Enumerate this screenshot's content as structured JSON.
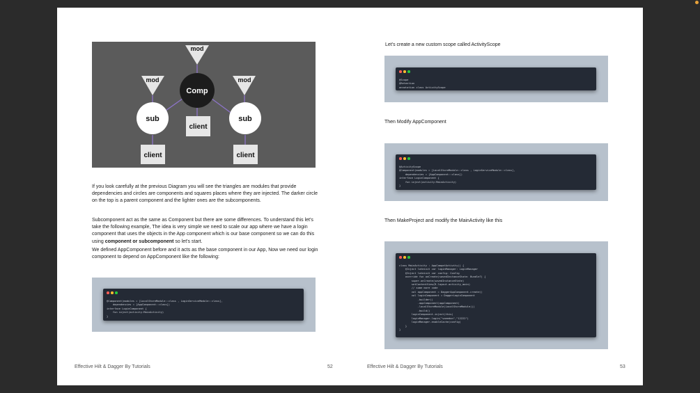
{
  "left_page": {
    "paragraph1": "If you look carefully at the previous Diagram you will see the triangles are modules that provide dependencies and circles are components and squares places where they are injected. The darker circle on the top is a parent component and the lighter ones are the subcomponents.",
    "paragraph2_text": "Subcomponent act as the same as Component but there are some differences. To understand this let's take the following example, The idea is very simple we need to scale our app where we have a login component that uses the objects in the App component which is our base component so we can do this using ",
    "paragraph2_bold": "component or subcomponent",
    "paragraph2_tail": " so let's start.",
    "paragraph3": "We defined AppComponent before and it acts as the base component in our App, Now we need our login component to depend on AppComponent like the following:",
    "footer_title": "Effective Hilt & Dagger By Tutorials",
    "page_number": "52",
    "diagram": {
      "mod_top": "mod",
      "mod_left": "mod",
      "mod_right": "mod",
      "comp": "Comp",
      "sub_left": "sub",
      "sub_right": "sub",
      "client_center": "client",
      "client_left": "client",
      "client_right": "client"
    },
    "code1": "@Component(modules = [LocalStoreModule::class , LoginServiceModule::class],\n    dependencies = [AppComponent::class])\ninterface LoginComponent {\n    fun inject(activity:MainActivity)\n}"
  },
  "right_page": {
    "caption1": "Let's create a new custom scope called ActivityScope",
    "code1": "@Scope\n@Retention\nannotation class ActivityScope",
    "caption2": "Then Modify AppComponent",
    "code2": "@ActivityScope\n@Component(modules = [LocalStoreModule::class , LoginServiceModule::class],\n    dependencies = [AppComponent::class])\ninterface LoginComponent {\n    fun inject(activity:MainActivity)\n}",
    "caption3": "Then MakeProject and modify the MainActivity like this",
    "code3": "class MainActivity : AppCompatActivity() {\n    @Inject lateinit var loginManager: LoginManager\n    @Inject lateinit var config: Config\n    override fun onCreate(savedInstanceState: Bundle?) {\n        super.onCreate(savedInstanceState)\n        setContentView(R.layout.activity_main)\n        // some more code\n        val appComponent = DaggerAppComponent.create()\n        val loginComponent = DaggerLoginComponent\n            .builder()\n            .appComponent(appComponent)\n            .localStoreModule(LocalStoreModule())\n            .build()\n        loginComponent.inject(this)\n        loginManager.login(\"saeedon\",\"12222\")\n        loginManager.enableCache(config)\n    }\n}",
    "footer_title": "Effective Hilt & Dagger By Tutorials",
    "page_number": "53"
  },
  "colors": {
    "diagram_bg": "#5b5b5b",
    "comp_fill": "#1c1c1c",
    "edge": "#8d74c9",
    "code_bg": "#242a35",
    "code_frame": "#b7c1cc"
  }
}
